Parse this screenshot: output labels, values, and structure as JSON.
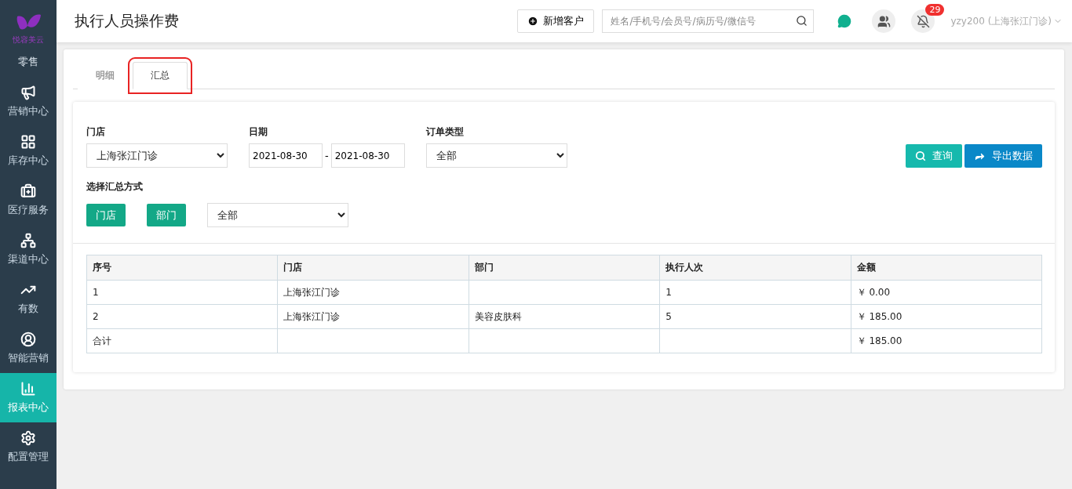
{
  "sidebar": {
    "logo_text": "悦容美云",
    "mode_label": "零售",
    "items": [
      {
        "label": "营销中心",
        "selected": false
      },
      {
        "label": "库存中心",
        "selected": false
      },
      {
        "label": "医疗服务",
        "selected": false
      },
      {
        "label": "渠道中心",
        "selected": false
      },
      {
        "label": "有数",
        "selected": false
      },
      {
        "label": "智能营销",
        "selected": false
      },
      {
        "label": "报表中心",
        "selected": true
      },
      {
        "label": "配置管理",
        "selected": false
      }
    ]
  },
  "header": {
    "title": "执行人员操作费",
    "add_button": "新增客户",
    "search": {
      "placeholder": "姓名/手机号/会员号/病历号/微信号"
    },
    "notification_count": "29",
    "user": "yzy200 (上海张江门诊)"
  },
  "tabs": [
    {
      "label": "明细",
      "selected": false
    },
    {
      "label": "汇总",
      "selected": true
    }
  ],
  "highlight_selected_tab": true,
  "filters": {
    "store": {
      "label": "门店",
      "value": "上海张江门诊"
    },
    "date": {
      "label": "日期",
      "from": "2021-08-30",
      "separator": "-",
      "to": "2021-08-30"
    },
    "order_type": {
      "label": "订单类型",
      "value": "全部"
    },
    "query_button": "查询",
    "export_button": "导出数据"
  },
  "summary_mode": {
    "label": "选择汇总方式",
    "buttons": [
      "门店",
      "部门"
    ],
    "value": "全部"
  },
  "table": {
    "columns": [
      "序号",
      "门店",
      "部门",
      "执行人次",
      "金额"
    ],
    "rows": [
      [
        "1",
        "上海张江门诊",
        "",
        "1",
        "￥ 0.00"
      ],
      [
        "2",
        "上海张江门诊",
        "美容皮肤科",
        "5",
        "￥ 185.00"
      ],
      [
        "合计",
        "",
        "",
        "",
        "￥ 185.00"
      ]
    ]
  }
}
